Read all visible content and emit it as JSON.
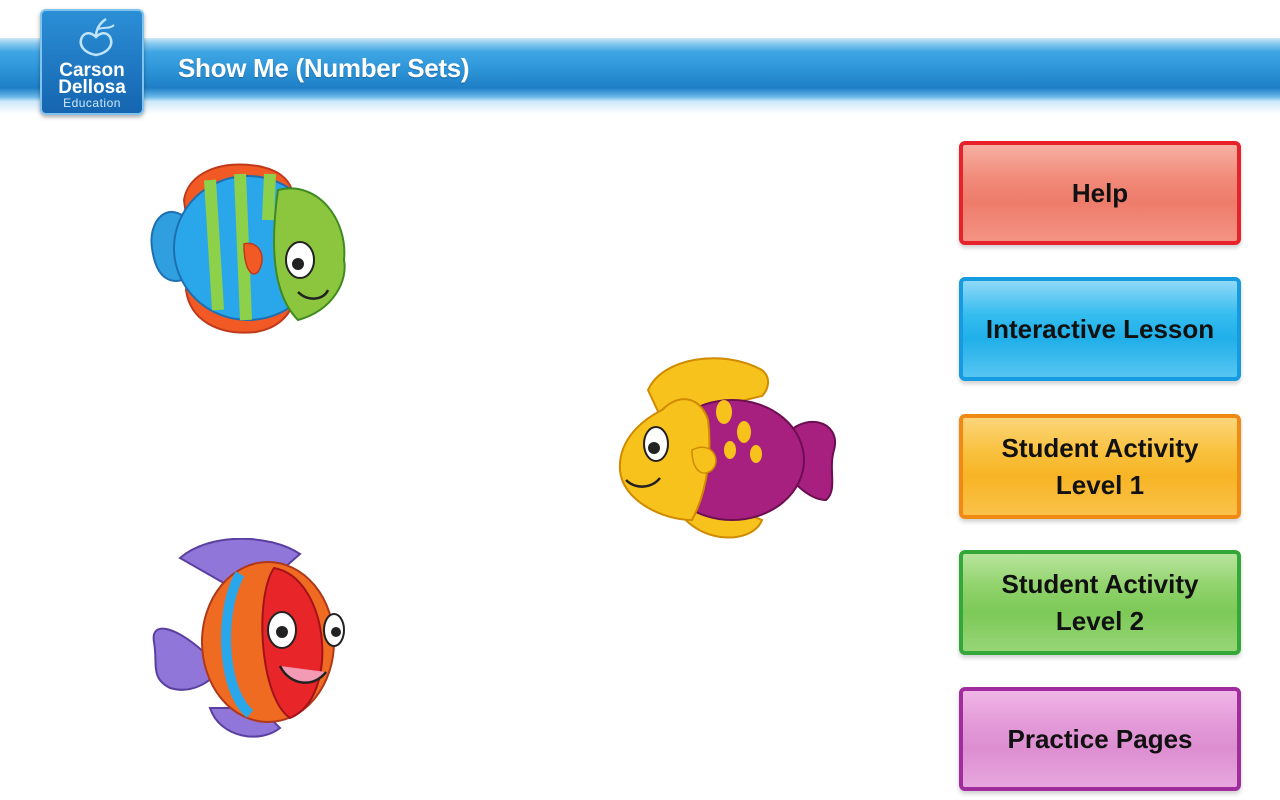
{
  "header": {
    "title": "Show Me (Number Sets)",
    "logo": {
      "line1": "Carson",
      "line2": "Dellosa",
      "line3": "Education"
    }
  },
  "menu": {
    "help": "Help",
    "interactive_lesson": "Interactive Lesson",
    "student_activity_1": "Student Activity\nLevel 1",
    "student_activity_2": "Student Activity\nLevel 2",
    "practice_pages": "Practice Pages"
  },
  "colors": {
    "header_blue": "#2d94d8",
    "help_red": "#e8222a",
    "lesson_blue": "#169ae0",
    "level1_orange": "#f08a12",
    "level2_green": "#33a838",
    "practice_purple": "#a12c9d"
  },
  "decorations": [
    "fish-blue-green",
    "fish-yellow-purple",
    "fish-orange-purple"
  ]
}
